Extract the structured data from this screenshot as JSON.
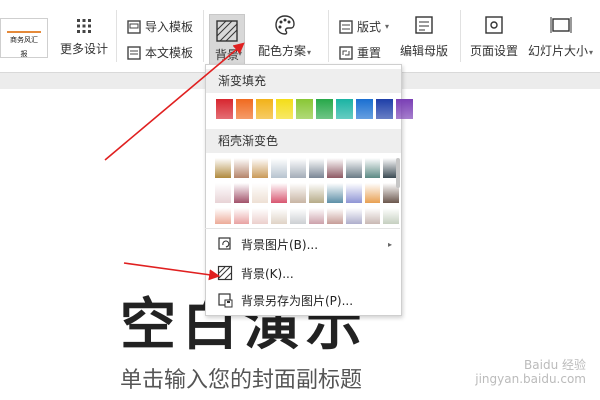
{
  "ribbon": {
    "thumb_text": "商务风汇报",
    "more_design": "更多设计",
    "import_template": "导入模板",
    "text_template": "本文模板",
    "background": "背景",
    "color_scheme": "配色方案",
    "layout": "版式",
    "reset": "重置",
    "edit_master": "编辑母版",
    "page_setup": "页面设置",
    "slide_size": "幻灯片大小"
  },
  "menu": {
    "gradient_fill_title": "渐变填充",
    "gradient_swatches": [
      "#d7262f",
      "#f06a1f",
      "#f2b219",
      "#f4dd18",
      "#89c735",
      "#27a84a",
      "#1ab3a3",
      "#1a6fd1",
      "#1e3fa8",
      "#7a3fb5"
    ],
    "daoke_title": "稻壳渐变色",
    "daoke_rows": [
      [
        "#b08a3e",
        "#b5846a",
        "#c99a58",
        "#b7c3cf",
        "#a4adb8",
        "#7a8695",
        "#8f5a64",
        "#6a7b86",
        "#5c8a84",
        "#3b4b53"
      ],
      [
        "#e8d3d6",
        "#a2526a",
        "#eee0d4",
        "#d85670",
        "#c8b5a4",
        "#b6ab88",
        "#5d8fa7",
        "#8f95d5",
        "#e8a052",
        "#6b574d"
      ],
      [
        "#e8967f",
        "#e38b8b",
        "#e7c3c0",
        "#d8c8b8",
        "#c0c4c8",
        "#c08a96",
        "#b8857e",
        "#9b9abf",
        "#bca7a1",
        "#b7c3b0"
      ]
    ],
    "items": [
      {
        "label": "背景图片(B)...",
        "icon": "image-refresh-icon",
        "has_submenu": true
      },
      {
        "label": "背景(K)...",
        "icon": "background-hatch-icon",
        "has_submenu": false
      },
      {
        "label": "背景另存为图片(P)...",
        "icon": "save-as-image-icon",
        "has_submenu": false
      }
    ]
  },
  "slide": {
    "title": "空白演示",
    "subtitle": "单击输入您的封面副标题"
  },
  "watermark": {
    "line1": "Baidu 经验",
    "line2": "jingyan.baidu.com"
  },
  "colors": {
    "arrow_red": "#e02020"
  }
}
